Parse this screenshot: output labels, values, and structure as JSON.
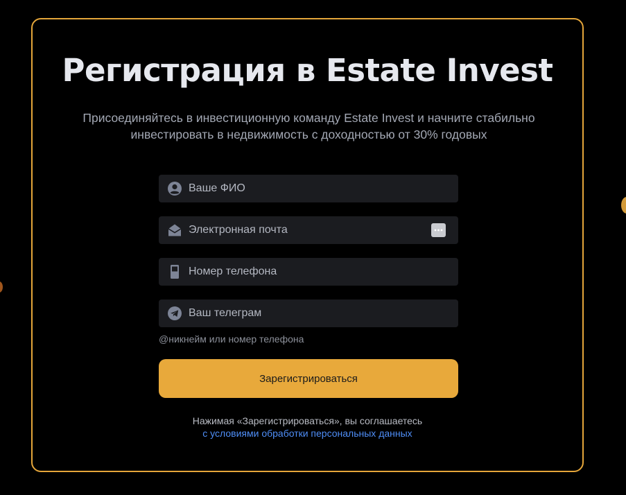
{
  "form": {
    "title": "Регистрация в Estate Invest",
    "subtitle": "Присоединяйтесь в инвестиционную команду Estate Invest и начните стабильно инвестировать в недвижимость с доходностью от 30% годовых",
    "fields": {
      "name": {
        "placeholder": "Ваше ФИО",
        "value": "",
        "icon": "user-circle-icon"
      },
      "email": {
        "placeholder": "Электронная почта",
        "value": "",
        "icon": "envelope-open-icon"
      },
      "phone": {
        "placeholder": "Номер телефона",
        "value": "",
        "icon": "mobile-phone-icon"
      },
      "telegram": {
        "placeholder": "Ваш телеграм",
        "value": "",
        "icon": "telegram-icon"
      }
    },
    "telegram_hint": "@никнейм или номер телефона",
    "submit_label": "Зарегистрироваться",
    "agreement_text": "Нажимая «Зарегистрироваться», вы соглашаетесь",
    "agreement_link": "с условиями обработки персональных данных"
  },
  "colors": {
    "background": "#000000",
    "accent": "#e8a93b",
    "card_border": "#e5a63a",
    "field_bg": "#1b1c20",
    "link": "#4f8ef7"
  }
}
